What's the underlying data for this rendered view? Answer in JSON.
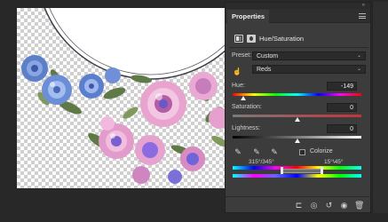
{
  "panel": {
    "tab_label": "Properties",
    "adjustment_label": "Hue/Saturation",
    "preset_label": "Preset:",
    "preset_value": "Custom",
    "channel_value": "Reds",
    "hue": {
      "label": "Hue:",
      "value": "-149",
      "level": 0.086
    },
    "saturation": {
      "label": "Saturation:",
      "value": "0",
      "level": 0.5
    },
    "lightness": {
      "label": "Lightness:",
      "value": "0",
      "level": 0.5
    },
    "colorize_label": "Colorize",
    "colorize_checked": false,
    "range_left": "315°/345°",
    "range_right": "15°\\45°"
  },
  "icons": {
    "eyedroppers": [
      "eyedropper-icon",
      "eyedropper-plus-icon",
      "eyedropper-minus-icon"
    ],
    "bottom": [
      "clip-to-layer-icon",
      "view-previous-state-icon",
      "reset-icon",
      "visibility-eye-icon",
      "trash-icon"
    ]
  },
  "colors": {
    "panel_bg": "#3c3c3c",
    "field_bg": "#2b2b2b",
    "workspace_bg": "#282828"
  }
}
